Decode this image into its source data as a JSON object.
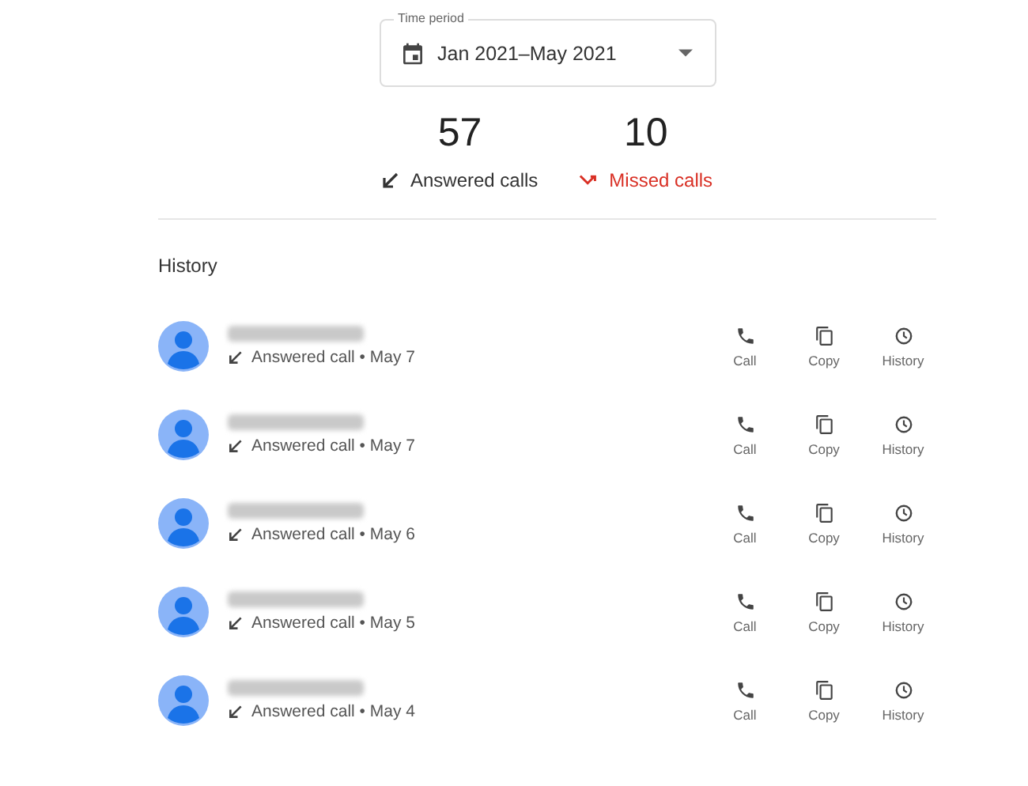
{
  "time_period": {
    "label": "Time period",
    "value": "Jan 2021–May 2021"
  },
  "stats": [
    {
      "kind": "answered",
      "count": "57",
      "label": "Answered calls"
    },
    {
      "kind": "missed",
      "count": "10",
      "label": "Missed calls"
    }
  ],
  "history": {
    "title": "History",
    "calls": [
      {
        "redacted": true,
        "detail": "Answered call • May 7",
        "actions": [
          {
            "kind": "call",
            "label": "Call"
          },
          {
            "kind": "copy",
            "label": "Copy"
          },
          {
            "kind": "history",
            "label": "History"
          }
        ]
      },
      {
        "redacted": true,
        "detail": "Answered call • May 7",
        "actions": [
          {
            "kind": "call",
            "label": "Call"
          },
          {
            "kind": "copy",
            "label": "Copy"
          },
          {
            "kind": "history",
            "label": "History"
          }
        ]
      },
      {
        "redacted": true,
        "detail": "Answered call • May 6",
        "actions": [
          {
            "kind": "call",
            "label": "Call"
          },
          {
            "kind": "copy",
            "label": "Copy"
          },
          {
            "kind": "history",
            "label": "History"
          }
        ]
      },
      {
        "redacted": true,
        "detail": "Answered call • May 5",
        "actions": [
          {
            "kind": "call",
            "label": "Call"
          },
          {
            "kind": "copy",
            "label": "Copy"
          },
          {
            "kind": "history",
            "label": "History"
          }
        ]
      },
      {
        "redacted": true,
        "detail": "Answered call • May 4",
        "actions": [
          {
            "kind": "call",
            "label": "Call"
          },
          {
            "kind": "copy",
            "label": "Copy"
          },
          {
            "kind": "history",
            "label": "History"
          }
        ]
      }
    ]
  }
}
